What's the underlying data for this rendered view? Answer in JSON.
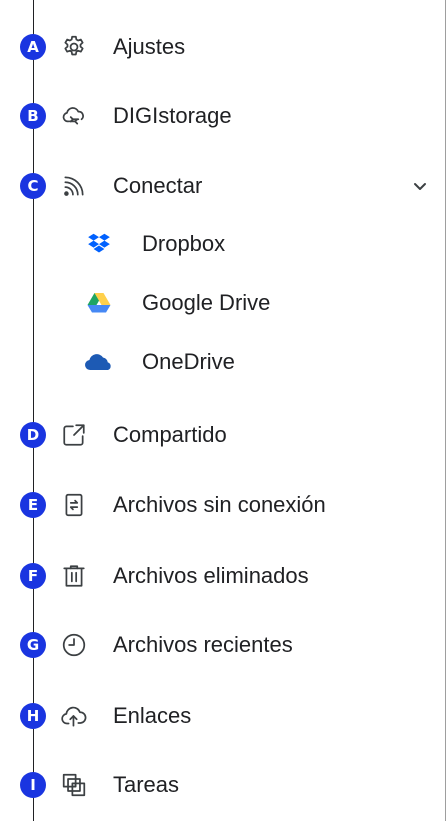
{
  "menu": {
    "items": [
      {
        "badge": "A",
        "label": "Ajustes",
        "icon": "gear-icon"
      },
      {
        "badge": "B",
        "label": "DIGIstorage",
        "icon": "cloud-sync-icon"
      },
      {
        "badge": "C",
        "label": "Conectar",
        "icon": "wifi-connect-icon",
        "expanded": true,
        "children": [
          {
            "label": "Dropbox",
            "icon": "dropbox-icon"
          },
          {
            "label": "Google Drive",
            "icon": "google-drive-icon"
          },
          {
            "label": "OneDrive",
            "icon": "onedrive-icon"
          }
        ]
      },
      {
        "badge": "D",
        "label": "Compartido",
        "icon": "share-external-icon"
      },
      {
        "badge": "E",
        "label": "Archivos sin conexión",
        "icon": "offline-files-icon"
      },
      {
        "badge": "F",
        "label": "Archivos eliminados",
        "icon": "trash-icon"
      },
      {
        "badge": "G",
        "label": "Archivos recientes",
        "icon": "clock-icon"
      },
      {
        "badge": "H",
        "label": "Enlaces",
        "icon": "cloud-upload-icon"
      },
      {
        "badge": "I",
        "label": "Tareas",
        "icon": "tasks-icon"
      }
    ]
  },
  "colors": {
    "badge": "#1a35e0",
    "text": "#202124",
    "icon": "#3c4043",
    "dropbox": "#0061fe",
    "onedrive": "#1d5ab4"
  }
}
